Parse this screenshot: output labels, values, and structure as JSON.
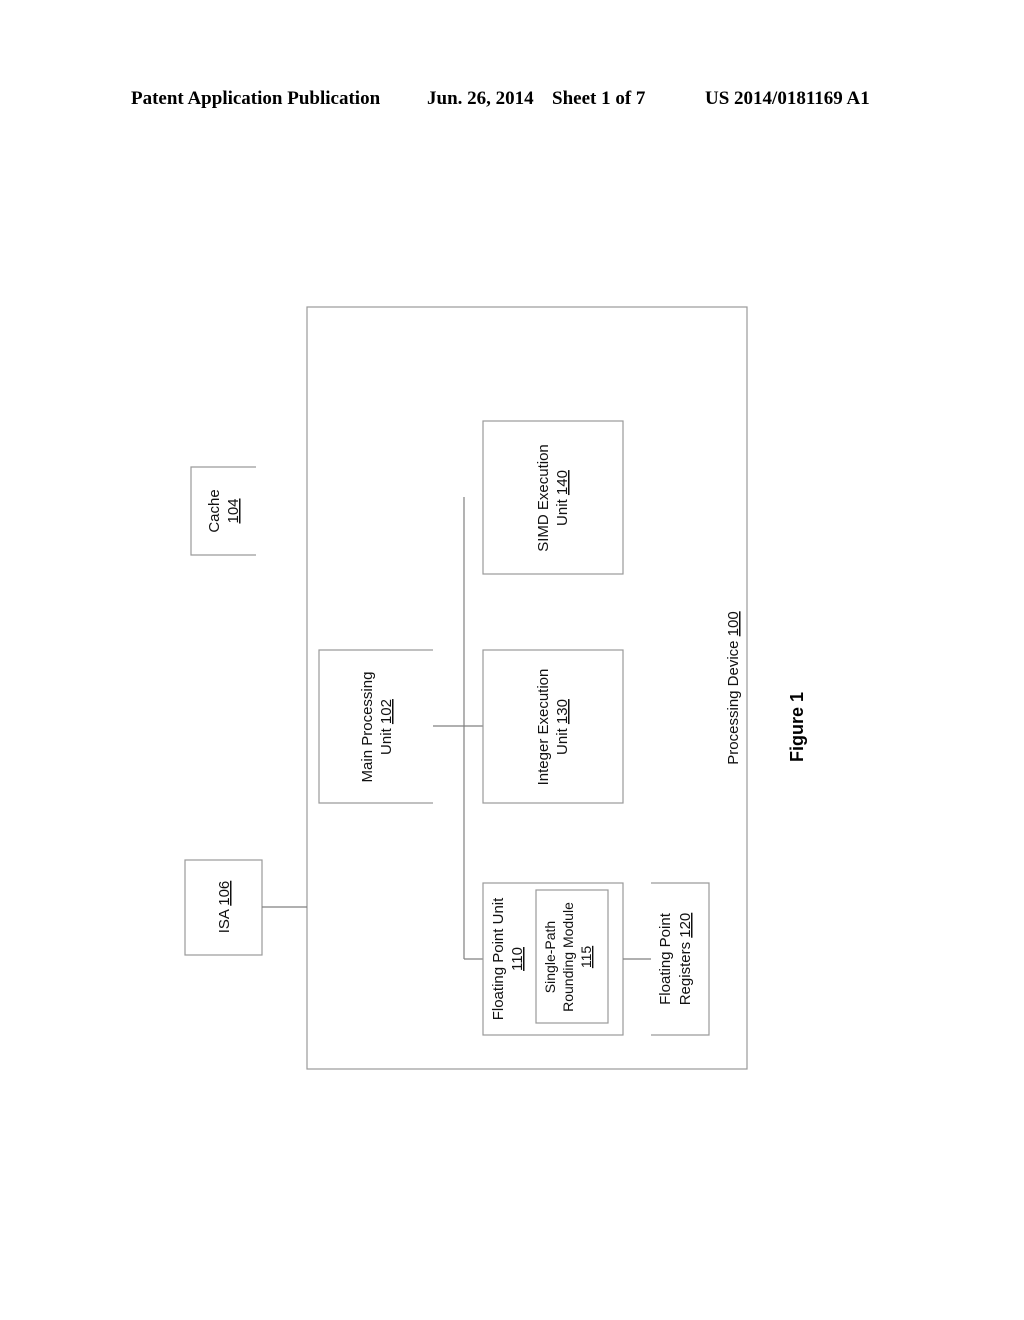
{
  "header": {
    "publication": "Patent Application Publication",
    "date": "Jun. 26, 2014",
    "sheet": "Sheet 1 of 7",
    "number": "US 2014/0181169 A1"
  },
  "figure": {
    "caption": "Figure 1",
    "blocks": {
      "cache": {
        "name": "Cache",
        "ref": "104"
      },
      "isa": {
        "name": "ISA",
        "ref": "106"
      },
      "processing_device": {
        "name": "Processing Device",
        "ref": "100"
      },
      "main_processing_unit": {
        "line1": "Main Processing",
        "line2": "Unit",
        "ref": "102"
      },
      "simd_execution_unit": {
        "line1": "SIMD Execution",
        "line2": "Unit",
        "ref": "140"
      },
      "integer_execution_unit": {
        "line1": "Integer Execution",
        "line2": "Unit",
        "ref": "130"
      },
      "floating_point_unit": {
        "line1": "Floating Point Unit",
        "ref": "110"
      },
      "rounding_module": {
        "line1": "Single-Path",
        "line2": "Rounding Module",
        "ref": "115"
      },
      "floating_point_registers": {
        "line1": "Floating Point",
        "line2": "Registers",
        "ref": "120"
      }
    }
  }
}
